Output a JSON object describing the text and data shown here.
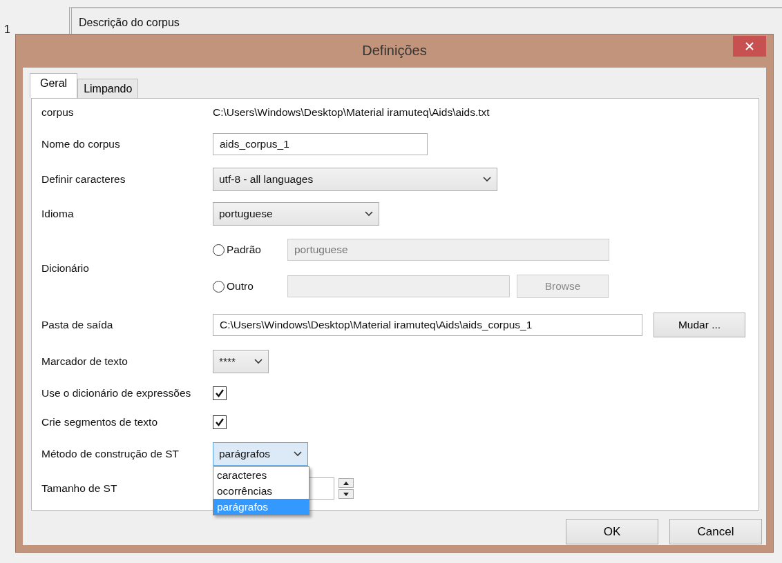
{
  "background": {
    "marker": "1",
    "panel_title": "Descrição do corpus"
  },
  "dialog": {
    "title": "Definições",
    "tabs": [
      {
        "label": "Geral",
        "selected": true
      },
      {
        "label": "Limpando",
        "selected": false
      }
    ],
    "fields": [
      {
        "kind": "text",
        "label": "corpus",
        "value": "C:\\Users\\Windows\\Desktop\\Material iramuteq\\Aids\\aids.txt"
      },
      {
        "kind": "input",
        "label": "Nome do corpus",
        "value": "aids_corpus_1"
      },
      {
        "kind": "select",
        "label": "Definir caracteres",
        "value": "utf-8 - all languages",
        "open": false
      },
      {
        "kind": "select",
        "label": "Idioma",
        "value": "portuguese",
        "open": false
      },
      {
        "kind": "radios",
        "label": "Dicionário",
        "options": [
          {
            "label": "Padrão",
            "selected": false,
            "value": "portuguese"
          },
          {
            "label": "Outro",
            "selected": false,
            "button": "Browse"
          }
        ]
      },
      {
        "kind": "path",
        "label": "Pasta de saída",
        "value": "C:\\Users\\Windows\\Desktop\\Material iramuteq\\Aids\\aids_corpus_1",
        "button": "Mudar ..."
      },
      {
        "kind": "select",
        "label": "Marcador de texto",
        "value": "****",
        "open": false
      },
      {
        "kind": "checkbox",
        "label": "Use o dicionário de expressões",
        "checked": true
      },
      {
        "kind": "checkbox",
        "label": "Crie segmentos de texto",
        "checked": true
      },
      {
        "kind": "select",
        "label": "Método de construção de ST",
        "value": "parágrafos",
        "open": true,
        "options": [
          {
            "label": "caracteres",
            "selected": false
          },
          {
            "label": "ocorrências",
            "selected": false
          },
          {
            "label": "parágrafos",
            "selected": true
          }
        ]
      },
      {
        "kind": "spinner",
        "label": "Tamanho de ST"
      }
    ],
    "buttons": [
      "OK",
      "Cancel"
    ]
  }
}
